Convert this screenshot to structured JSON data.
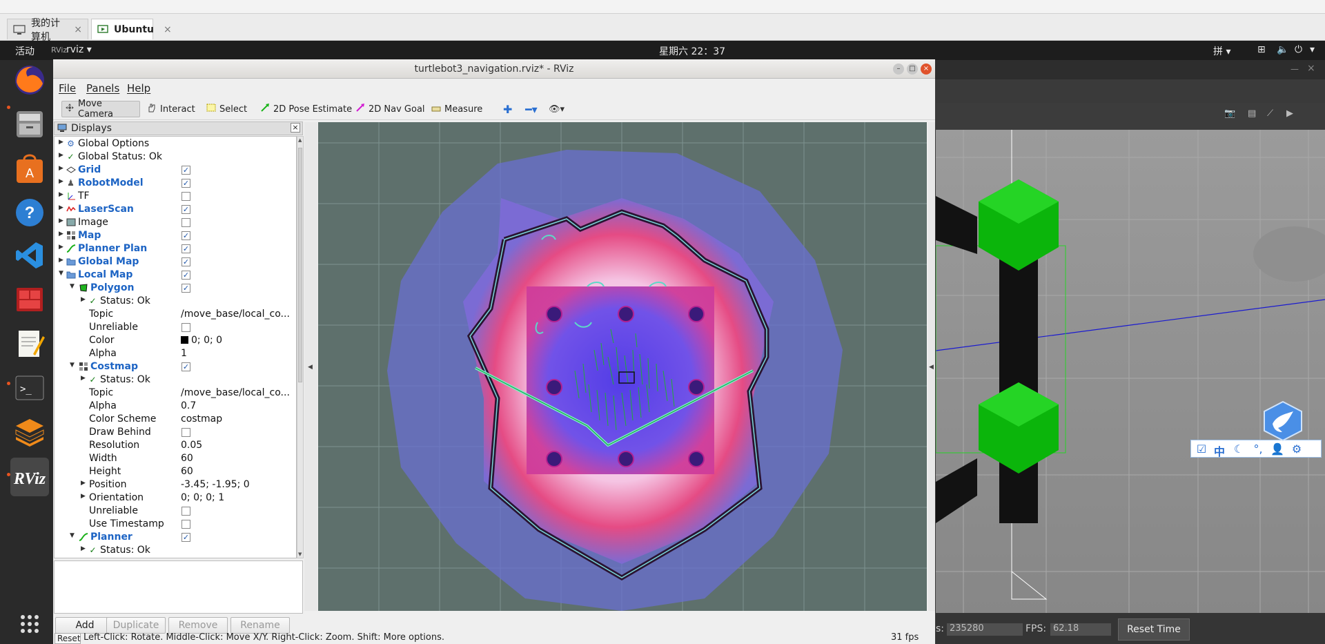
{
  "host": {
    "tabs": [
      {
        "label": "我的计算机",
        "close": "×"
      },
      {
        "label": "Ubuntu",
        "close": "×"
      }
    ]
  },
  "top_panel": {
    "activities": "活动",
    "app_menu": "rviz ▾",
    "clock": "星期六 22：37",
    "input_method": "拼 ▾"
  },
  "rviz": {
    "title": "turtlebot3_navigation.rviz* - RViz",
    "menu": {
      "file": "File",
      "panels": "Panels",
      "help": "Help"
    },
    "toolbar": {
      "move_camera": "Move Camera",
      "interact": "Interact",
      "select": "Select",
      "pose_estimate": "2D Pose Estimate",
      "nav_goal": "2D Nav Goal",
      "measure": "Measure"
    },
    "displays": {
      "title": "Displays",
      "rows": [
        {
          "label": "Global Options",
          "value": ""
        },
        {
          "label": "Global Status: Ok",
          "value": ""
        },
        {
          "label": "Grid",
          "value": ""
        },
        {
          "label": "RobotModel",
          "value": ""
        },
        {
          "label": "TF",
          "value": ""
        },
        {
          "label": "LaserScan",
          "value": ""
        },
        {
          "label": "Image",
          "value": ""
        },
        {
          "label": "Map",
          "value": ""
        },
        {
          "label": "Planner Plan",
          "value": ""
        },
        {
          "label": "Global Map",
          "value": ""
        },
        {
          "label": "Local Map",
          "value": ""
        },
        {
          "label": "Polygon",
          "value": ""
        },
        {
          "label": "Status: Ok",
          "value": ""
        },
        {
          "label": "Topic",
          "value": "/move_base/local_co..."
        },
        {
          "label": "Unreliable",
          "value": ""
        },
        {
          "label": "Color",
          "value": "0; 0; 0"
        },
        {
          "label": "Alpha",
          "value": "1"
        },
        {
          "label": "Costmap",
          "value": ""
        },
        {
          "label": "Status: Ok",
          "value": ""
        },
        {
          "label": "Topic",
          "value": "/move_base/local_co..."
        },
        {
          "label": "Alpha",
          "value": "0.7"
        },
        {
          "label": "Color Scheme",
          "value": "costmap"
        },
        {
          "label": "Draw Behind",
          "value": ""
        },
        {
          "label": "Resolution",
          "value": "0.05"
        },
        {
          "label": "Width",
          "value": "60"
        },
        {
          "label": "Height",
          "value": "60"
        },
        {
          "label": "Position",
          "value": "-3.45; -1.95; 0"
        },
        {
          "label": "Orientation",
          "value": "0; 0; 0; 1"
        },
        {
          "label": "Unreliable",
          "value": ""
        },
        {
          "label": "Use Timestamp",
          "value": ""
        },
        {
          "label": "Planner",
          "value": ""
        },
        {
          "label": "Status: Ok",
          "value": ""
        }
      ]
    },
    "buttons": {
      "add": "Add",
      "duplicate": "Duplicate",
      "remove": "Remove",
      "rename": "Rename"
    },
    "status": {
      "reset": "Reset",
      "hint": "Left-Click: Rotate. Middle-Click: Move X/Y. Right-Click: Zoom. Shift: More options.",
      "fps": "31 fps"
    }
  },
  "gazebo": {
    "sim_time_label": "s:",
    "sim_time_value": "235280",
    "fps_label": "FPS:",
    "fps_value": "62.18",
    "reset_time": "Reset Time"
  },
  "ime": {
    "chinese": "中"
  },
  "colors": {
    "accent": "#e95420",
    "tree_blue": "#1d64c4",
    "view_bg": "#5e706c"
  }
}
